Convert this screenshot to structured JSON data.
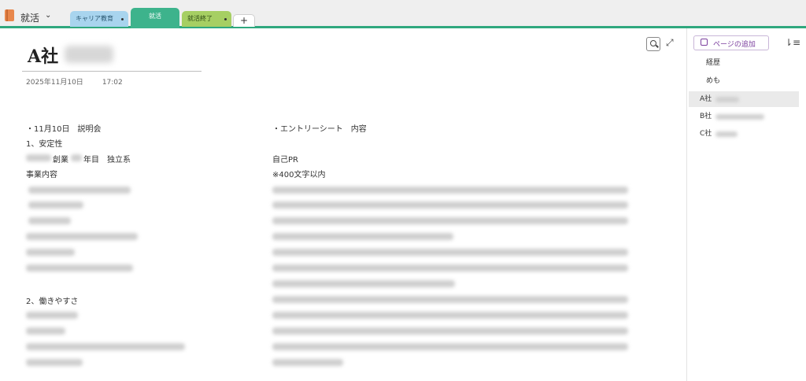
{
  "notebook": {
    "name": "就活"
  },
  "tabs": [
    {
      "label": "キャリア教育"
    },
    {
      "label": "就活"
    },
    {
      "label": "就活終了"
    },
    {
      "label": "+"
    }
  ],
  "page": {
    "title": "A社",
    "date": "2025年11月10日",
    "time": "17:02"
  },
  "left_column": {
    "line1": "・11月10日　説明会",
    "line2": "1、安定性",
    "line3_a": "創業",
    "line3_b": "年目　独立系",
    "line4": "事業内容",
    "line5": "2、働きやすさ"
  },
  "right_column": {
    "line1": "・エントリーシート　内容",
    "line2": "自己PR",
    "line3": "※400文字以内"
  },
  "sidebar": {
    "add_page": "ページの追加",
    "items": [
      {
        "label": "経歴"
      },
      {
        "label": "めも"
      },
      {
        "label": "A社"
      },
      {
        "label": "B社"
      },
      {
        "label": "C社"
      }
    ]
  }
}
